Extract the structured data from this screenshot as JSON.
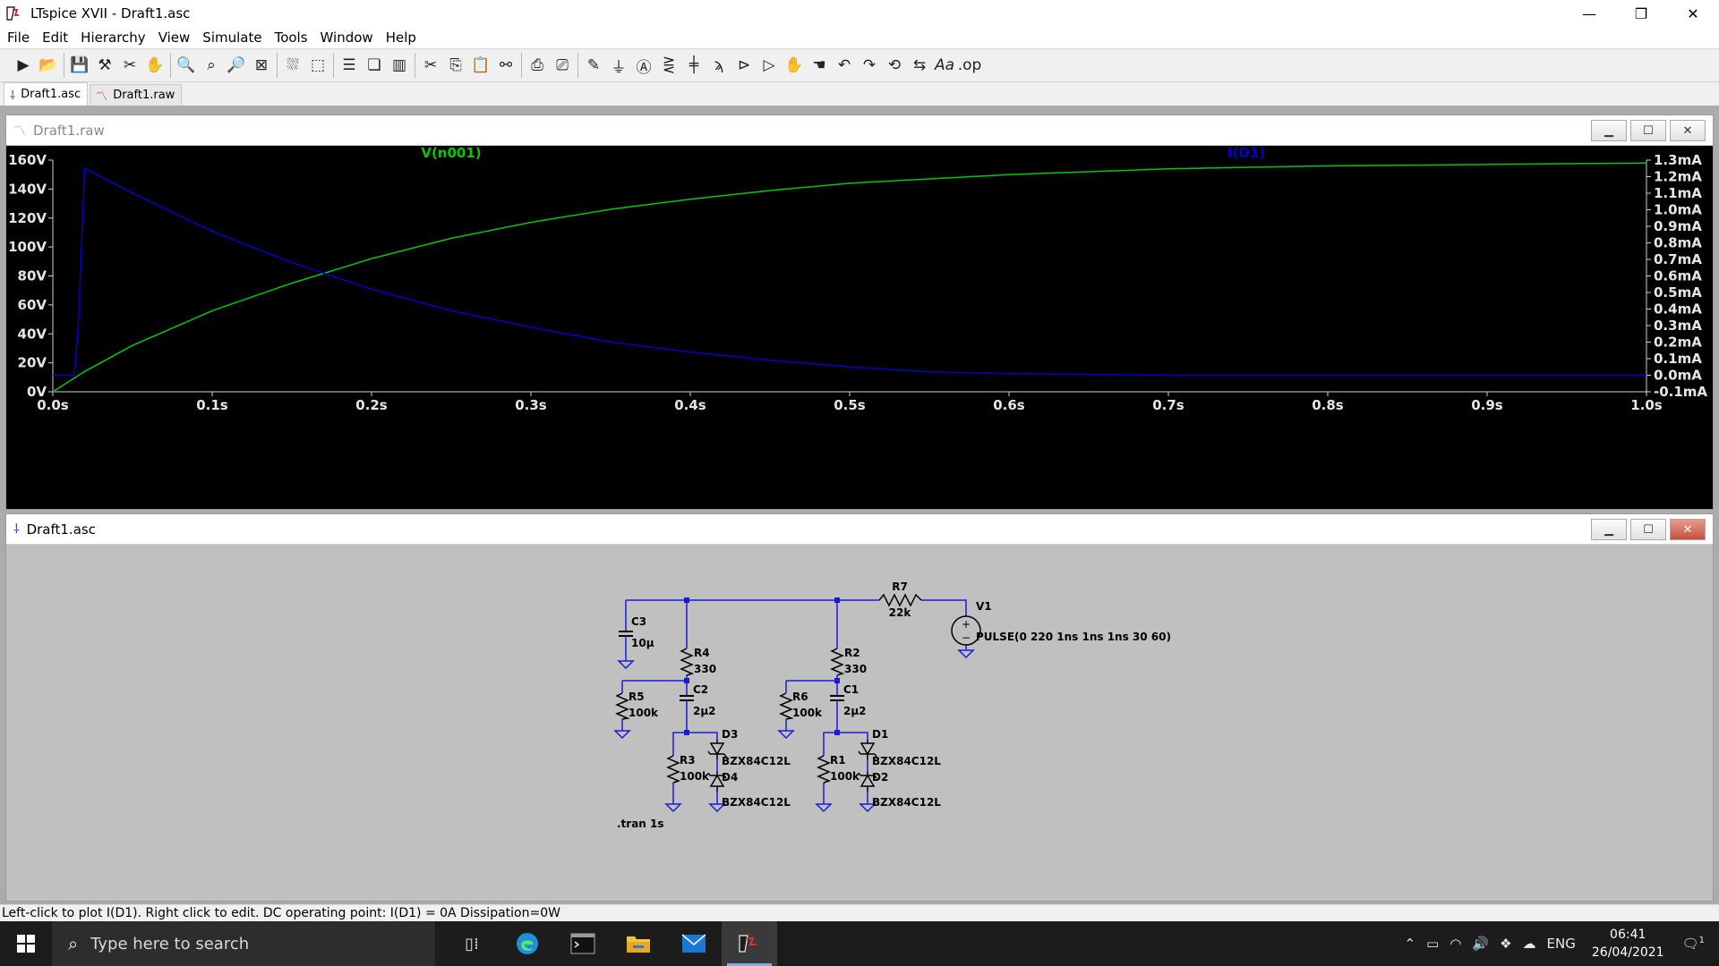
{
  "window": {
    "title": "LTspice XVII - Draft1.asc",
    "minimize": "—",
    "restore": "❐",
    "close": "✕"
  },
  "menu": [
    "File",
    "Edit",
    "Hierarchy",
    "View",
    "Simulate",
    "Tools",
    "Window",
    "Help"
  ],
  "toolbar_icons": [
    "run-icon",
    "open-icon",
    "save-icon",
    "control-panel-icon",
    "halt-icon",
    "pan-icon",
    "zoom-in-icon",
    "zoom-pan-icon",
    "zoom-out-icon",
    "zoom-fit-icon",
    "autorange-icon",
    "delete-plot-icon",
    "tile-horizontal-icon",
    "cascade-icon",
    "tile-vertical-icon",
    "cut-icon",
    "copy-icon",
    "paste-icon",
    "find-icon",
    "print-icon",
    "print-preview-icon",
    "wire-icon",
    "ground-icon",
    "label-icon",
    "resistor-icon",
    "capacitor-icon",
    "inductor-icon",
    "diode-icon",
    "component-icon",
    "move-icon",
    "drag-icon",
    "undo-icon",
    "redo-icon",
    "rotate-icon",
    "mirror-icon",
    "text-icon",
    "spice-directive-icon"
  ],
  "tabs": [
    {
      "label": "Draft1.asc",
      "icon": "schematic-icon",
      "active": true
    },
    {
      "label": "Draft1.raw",
      "icon": "waveform-icon",
      "active": false
    }
  ],
  "waveform_window": {
    "title": "Draft1.raw",
    "trace_left_label": "V(n001)",
    "trace_right_label": "I(D1)"
  },
  "chart_data": {
    "type": "line",
    "x_axis": {
      "ticks": [
        "0.0s",
        "0.1s",
        "0.2s",
        "0.3s",
        "0.4s",
        "0.5s",
        "0.6s",
        "0.7s",
        "0.8s",
        "0.9s",
        "1.0s"
      ],
      "range": [
        0,
        1.0
      ]
    },
    "y_left": {
      "ticks": [
        "0V",
        "20V",
        "40V",
        "60V",
        "80V",
        "100V",
        "120V",
        "140V",
        "160V"
      ],
      "range": [
        0,
        160
      ]
    },
    "y_right": {
      "ticks": [
        "-0.1mA",
        "0.0mA",
        "0.1mA",
        "0.2mA",
        "0.3mA",
        "0.4mA",
        "0.5mA",
        "0.6mA",
        "0.7mA",
        "0.8mA",
        "0.9mA",
        "1.0mA",
        "1.1mA",
        "1.2mA",
        "1.3mA"
      ],
      "range": [
        -0.1,
        1.3
      ]
    },
    "series": [
      {
        "name": "V(n001)",
        "axis": "left",
        "color": "#00c800",
        "x": [
          0,
          0.02,
          0.05,
          0.1,
          0.15,
          0.2,
          0.25,
          0.3,
          0.35,
          0.4,
          0.45,
          0.5,
          0.55,
          0.6,
          0.7,
          0.8,
          0.9,
          1.0
        ],
        "y": [
          0,
          14,
          32,
          56,
          75,
          92,
          106,
          117,
          126,
          133,
          139,
          144,
          147,
          150,
          154,
          156,
          157,
          158
        ]
      },
      {
        "name": "I(D1)",
        "axis": "right",
        "color": "#0000c8",
        "x": [
          0,
          0.0135,
          0.016,
          0.02,
          0.05,
          0.1,
          0.15,
          0.2,
          0.25,
          0.3,
          0.35,
          0.4,
          0.45,
          0.5,
          0.55,
          0.6,
          0.7,
          0.8,
          0.9,
          1.0
        ],
        "y": [
          0,
          0,
          0.3,
          1.25,
          1.1,
          0.87,
          0.68,
          0.52,
          0.39,
          0.29,
          0.2,
          0.14,
          0.09,
          0.05,
          0.02,
          0.01,
          0.0,
          0.0,
          0.0,
          0.0
        ]
      }
    ]
  },
  "schematic_window": {
    "title": "Draft1.asc",
    "components": {
      "R7": {
        "name": "R7",
        "value": "22k"
      },
      "V1": {
        "name": "V1",
        "value": "PULSE(0 220 1ns 1ns 1ns 30 60)"
      },
      "C3": {
        "name": "C3",
        "value": "10µ"
      },
      "R4": {
        "name": "R4",
        "value": "330"
      },
      "R2": {
        "name": "R2",
        "value": "330"
      },
      "R5": {
        "name": "R5",
        "value": "100k"
      },
      "R6": {
        "name": "R6",
        "value": "100k"
      },
      "C2": {
        "name": "C2",
        "value": "2µ2"
      },
      "C1": {
        "name": "C1",
        "value": "2µ2"
      },
      "R3": {
        "name": "R3",
        "value": "100k"
      },
      "R1": {
        "name": "R1",
        "value": "100k"
      },
      "D3": {
        "name": "D3",
        "value": "BZX84C12L"
      },
      "D4": {
        "name": "D4",
        "value": "BZX84C12L"
      },
      "D1": {
        "name": "D1",
        "value": "BZX84C12L"
      },
      "D2": {
        "name": "D2",
        "value": "BZX84C12L"
      }
    },
    "directive": ".tran 1s"
  },
  "statusbar": "Left-click to plot I(D1).  Right click to edit.  DC operating point: I(D1) = 0A   Dissipation=0W",
  "taskbar": {
    "search_placeholder": "Type here to search",
    "apps": [
      "task-view-icon",
      "edge-icon",
      "terminal-icon",
      "file-explorer-icon",
      "mail-icon",
      "ltspice-icon"
    ],
    "language": "ENG",
    "time": "06:41",
    "date": "26/04/2021",
    "notifications": "1"
  },
  "colors": {
    "trace_v": "#00c800",
    "trace_i": "#0000c8",
    "wire": "#1a1ad2",
    "schematic_bg": "#c0c0c0"
  }
}
